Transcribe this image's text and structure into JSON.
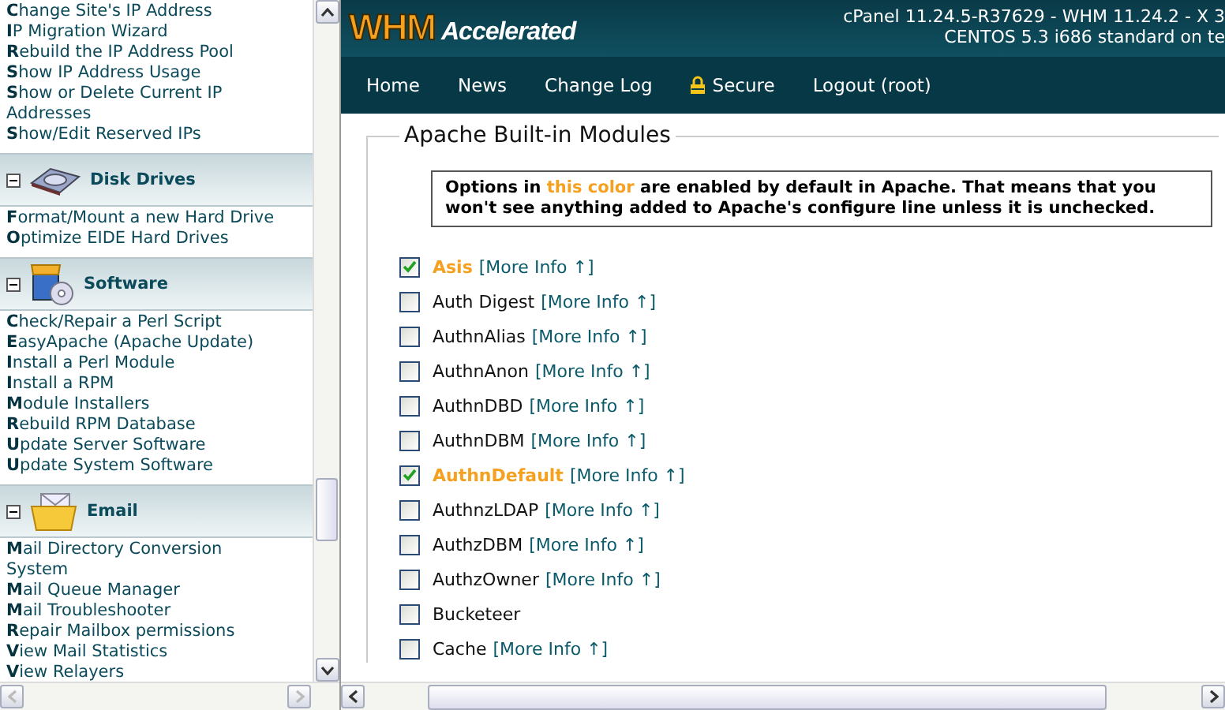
{
  "sidebar": {
    "sections": [
      {
        "items": [
          "**C**hange Site's IP Address",
          "**I**P Migration Wizard",
          "**R**ebuild the IP Address Pool",
          "**S**how IP Address Usage",
          "**S**how or Delete Current IP Addresses",
          "**S**how/Edit Reserved IPs"
        ]
      },
      {
        "title": "Disk Drives",
        "expanded": true,
        "items": [
          "**F**ormat/Mount a new Hard Drive",
          "**O**ptimize EIDE Hard Drives"
        ]
      },
      {
        "title": "Software",
        "expanded": true,
        "items": [
          "**C**heck/Repair a Perl Script",
          "**E**asyApache (Apache Update)",
          "**I**nstall a Perl Module",
          "**I**nstall a RPM",
          "**M**odule Installers",
          "**R**ebuild RPM Database",
          "**U**pdate Server Software",
          "**U**pdate System Software"
        ]
      },
      {
        "title": "Email",
        "expanded": true,
        "items": [
          "**M**ail Directory Conversion System",
          "**M**ail Queue Manager",
          "**M**ail Troubleshooter",
          "**R**epair Mailbox permissions",
          "**V**iew Mail Statistics",
          "**V**iew Relayers"
        ]
      }
    ]
  },
  "header": {
    "logo_main": "WHM",
    "logo_sub": "Accelerated",
    "version_line": "cPanel 11.24.5-R37629 - WHM 11.24.2 - X 3",
    "os_line": "CENTOS 5.3 i686 standard on te"
  },
  "nav": [
    {
      "label": "Home"
    },
    {
      "label": "News"
    },
    {
      "label": "Change Log"
    },
    {
      "label": "Secure"
    },
    {
      "label": "Logout (root)"
    }
  ],
  "fieldset_title": "Apache Built-in Modules",
  "notice": {
    "before": "Options in ",
    "highlight": "this color",
    "after": " are enabled by default in Apache. That means that you won't see anything added to Apache's configure line unless it is unchecked."
  },
  "modules": [
    {
      "name": "Asis",
      "checked": true,
      "default": true,
      "more_info": "[More Info ↑]"
    },
    {
      "name": "Auth Digest",
      "checked": false,
      "default": false,
      "more_info": "[More Info ↑]"
    },
    {
      "name": "AuthnAlias",
      "checked": false,
      "default": false,
      "more_info": "[More Info ↑]"
    },
    {
      "name": "AuthnAnon",
      "checked": false,
      "default": false,
      "more_info": "[More Info ↑]"
    },
    {
      "name": "AuthnDBD",
      "checked": false,
      "default": false,
      "more_info": "[More Info ↑]"
    },
    {
      "name": "AuthnDBM",
      "checked": false,
      "default": false,
      "more_info": "[More Info ↑]"
    },
    {
      "name": "AuthnDefault",
      "checked": true,
      "default": true,
      "more_info": "[More Info ↑]"
    },
    {
      "name": "AuthnzLDAP",
      "checked": false,
      "default": false,
      "more_info": "[More Info ↑]"
    },
    {
      "name": "AuthzDBM",
      "checked": false,
      "default": false,
      "more_info": "[More Info ↑]"
    },
    {
      "name": "AuthzOwner",
      "checked": false,
      "default": false,
      "more_info": "[More Info ↑]"
    },
    {
      "name": "Bucketeer",
      "checked": false,
      "default": false
    },
    {
      "name": "Cache",
      "checked": false,
      "default": false,
      "more_info": "[More Info ↑]"
    }
  ]
}
